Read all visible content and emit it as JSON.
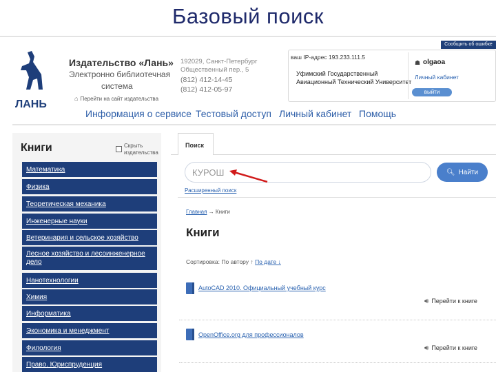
{
  "slide": {
    "title": "Базовый поиск"
  },
  "header": {
    "logo_text": "ЛАНЬ",
    "publisher_name": "Издательство «Лань»",
    "publisher_sub1": "Электронно библиотечная",
    "publisher_sub2": "система",
    "goto_site": "Перейти на сайт издательства",
    "address_line1": "192029, Санкт-Петербург",
    "address_line2": "Общественный пер., 5",
    "phone1": "(812) 412-14-45",
    "phone2": "(812) 412-05-97",
    "feedback_label": "Сообщить об ошибке",
    "ip_line": "ваш IP-адрес 193.233.111.5",
    "org_line1": "Уфимский Государственный",
    "org_line2": "Авиационный Технический Университет",
    "username": "olgaoa",
    "cabinet_link": "Личный кабинет",
    "logout_label": "выйти"
  },
  "nav": {
    "items": [
      {
        "label": "Информация о сервисе"
      },
      {
        "label": "Тестовый доступ"
      },
      {
        "label": "Личный кабинет"
      },
      {
        "label": "Помощь"
      }
    ]
  },
  "sidebar": {
    "title": "Книги",
    "hide_label": "Скрыть издательства",
    "categories": [
      {
        "label": "Математика"
      },
      {
        "label": "Физика"
      },
      {
        "label": "Теоретическая механика"
      },
      {
        "label": "Инженерные науки"
      },
      {
        "label": "Ветеринария и сельское хозяйство"
      },
      {
        "label": "Лесное хозяйство и лесоинженерное дело"
      },
      {
        "label": "Нанотехнологии"
      },
      {
        "label": "Химия"
      },
      {
        "label": "Информатика"
      },
      {
        "label": "Экономика и менеджмент"
      },
      {
        "label": "Филология"
      },
      {
        "label": "Право. Юриспруденция"
      }
    ]
  },
  "search": {
    "tab_label": "Поиск",
    "input_value": "КУРОШ",
    "button_label": "Найти",
    "advanced_link": "Расширенный поиск"
  },
  "content": {
    "breadcrumb_home": "Главная",
    "breadcrumb_sep": "→",
    "breadcrumb_current": "Книги",
    "title": "Книги",
    "sort_label": "Сортировка:",
    "sort_by_title": "По автору",
    "sort_arrow": "↑",
    "sort_by_date": "По дате ↓",
    "books": [
      {
        "title": "AutoCAD 2010. Официальный учебный курс",
        "read_label": "Перейти к книге"
      },
      {
        "title": "OpenOffice.org для профессионалов",
        "read_label": "Перейти к книге"
      }
    ]
  },
  "colors": {
    "category_bg": "#1e3e7a",
    "link": "#2a62b0",
    "accent_button": "#4a7fcb",
    "annotation_arrow": "#d11a1a"
  }
}
